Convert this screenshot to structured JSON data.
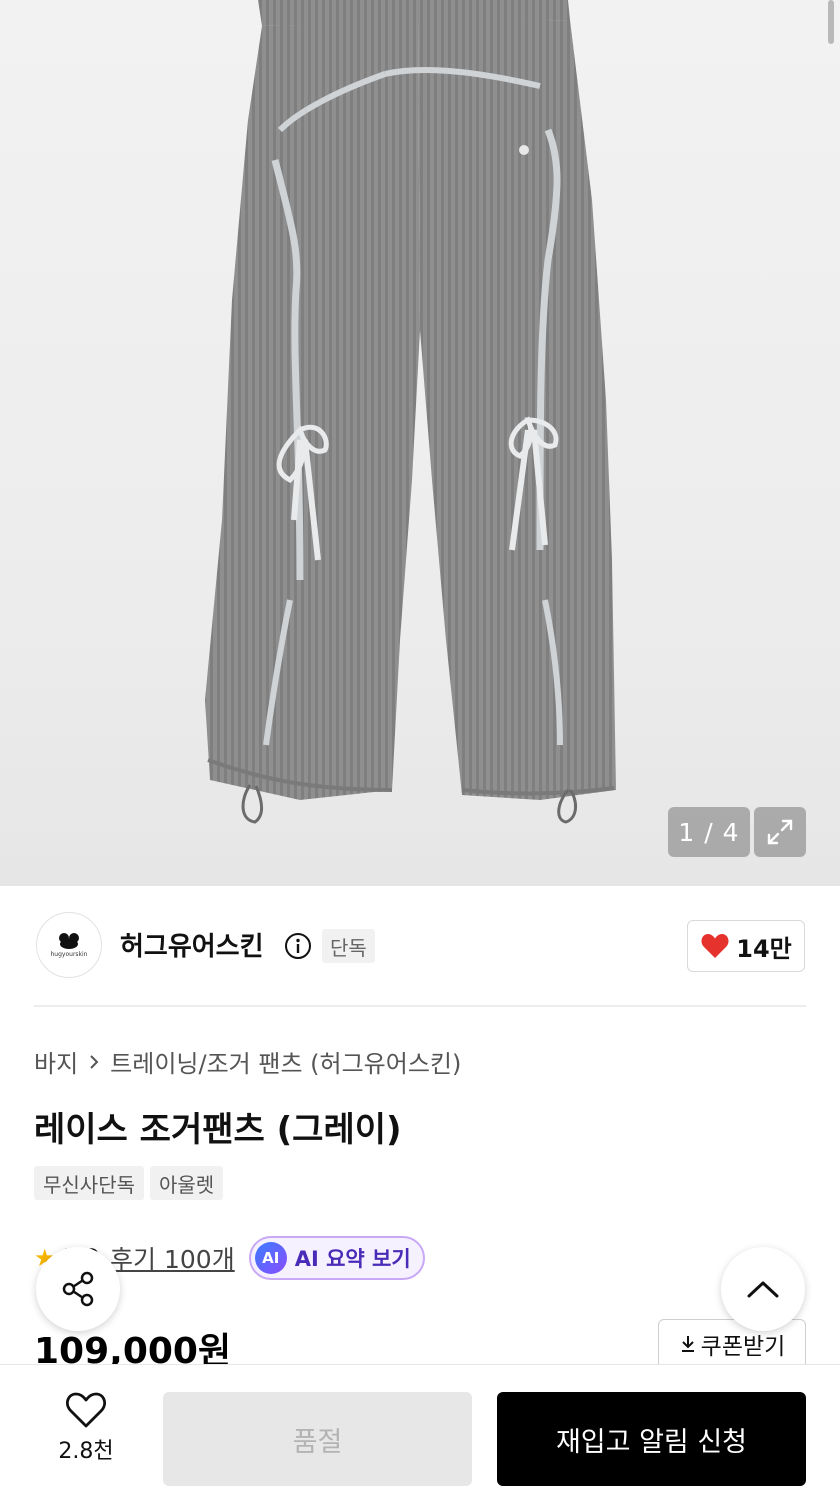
{
  "gallery": {
    "counter": "1 / 4",
    "image_description": "gray ribbed lace jogger pants"
  },
  "brand": {
    "name": "허그유어스킨",
    "logo_text": "hugyourskin",
    "badge": "단독",
    "likes": "14만"
  },
  "breadcrumb": {
    "category": "바지",
    "subcategory": "트레이닝/조거 팬츠 (허그유어스킨)"
  },
  "product": {
    "title": "레이스 조거팬츠 (그레이)",
    "tags": [
      "무신사단독",
      "아울렛"
    ],
    "rating": "4.9",
    "reviews": "후기 100개",
    "ai_summary": "AI 요약 보기",
    "ai_badge": "AI",
    "price": "109,000원"
  },
  "actions": {
    "coupon": "쿠폰받기",
    "wish_count": "2.8천",
    "soldout": "품절",
    "restock": "재입고 알림 신청"
  },
  "icons": {
    "info": "info-icon",
    "heart": "heart-icon",
    "share": "share-icon",
    "up": "chevron-up-icon",
    "expand": "expand-icon",
    "download": "download-icon",
    "star": "star-icon"
  },
  "colors": {
    "heart": "#e5322d",
    "ai_border": "#c9a9f5",
    "restock_bg": "#000000",
    "soldout_bg": "#e7e7e7"
  }
}
